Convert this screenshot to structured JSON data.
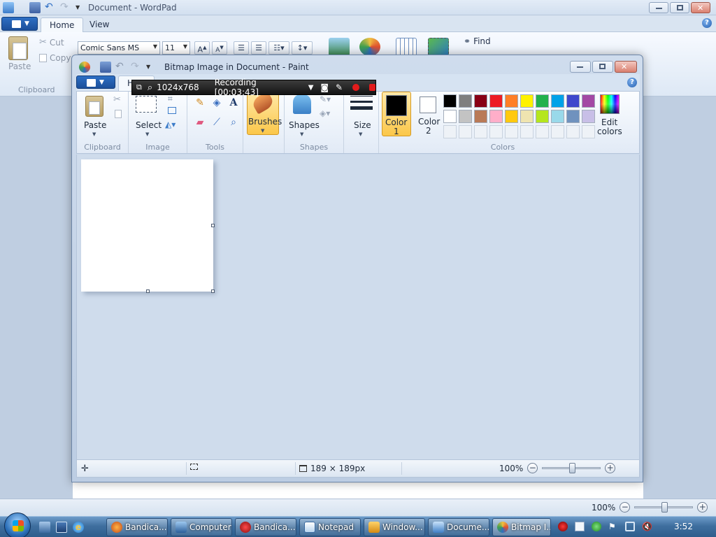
{
  "wordpad": {
    "title": "Document - WordPad",
    "tabs": {
      "home": "Home",
      "view": "View"
    },
    "help_glyph": "?",
    "clipboard": {
      "paste": "Paste",
      "cut": "Cut",
      "copy": "Copy",
      "group": "Clipboard"
    },
    "font": {
      "family": "Comic Sans MS",
      "size": "11"
    },
    "find": "Find",
    "zoom": {
      "value": "100%",
      "level_percent": 100
    }
  },
  "paint": {
    "title": "Bitmap Image in Document - Paint",
    "tab_home": "H",
    "help_glyph": "?",
    "groups": {
      "clipboard": "Clipboard",
      "image": "Image",
      "tools": "Tools",
      "shapes": "Shapes",
      "colors": "Colors"
    },
    "buttons": {
      "paste": "Paste",
      "select": "Select",
      "brushes": "Brushes",
      "shapes": "Shapes",
      "size": "Size",
      "color1": [
        "Color",
        "1"
      ],
      "color2": [
        "Color",
        "2"
      ],
      "edit_colors": [
        "Edit",
        "colors"
      ]
    },
    "colors": {
      "color1": "#000000",
      "color2": "#ffffff",
      "palette_row1": [
        "#000000",
        "#7f7f7f",
        "#880015",
        "#ed1c24",
        "#ff7f27",
        "#fff200",
        "#22b14c",
        "#00a2e8",
        "#3f48cc",
        "#a349a4"
      ],
      "palette_row2": [
        "#ffffff",
        "#c3c3c3",
        "#b97a57",
        "#ffaec9",
        "#ffc90e",
        "#efe4b0",
        "#b5e61d",
        "#99d9ea",
        "#7092be",
        "#c8bfe7"
      ]
    },
    "status": {
      "image_size": "189 × 189px",
      "zoom": "100%",
      "zoom_level_percent": 100
    }
  },
  "bandicam": {
    "resolution": "1024x768",
    "recording": "Recording [00:03:43]"
  },
  "taskbar": {
    "items": [
      "Bandica...",
      "Computer",
      "Bandica...",
      "Notepad",
      "Window...",
      "Docume...",
      "Bitmap I..."
    ],
    "clock": "3:52"
  }
}
